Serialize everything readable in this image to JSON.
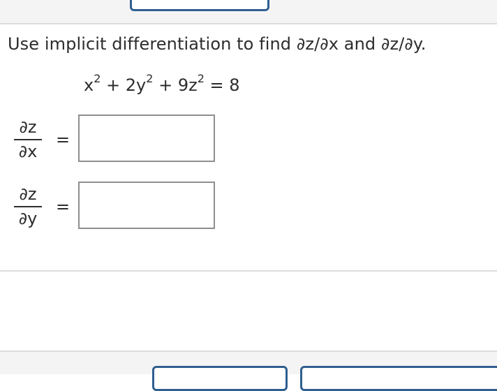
{
  "question": {
    "text": "Use implicit differentiation to find ∂z/∂x and ∂z/∂y."
  },
  "equation": {
    "term1_base": "x",
    "term1_exp": "2",
    "op1": " + ",
    "term2_base": "2y",
    "term2_exp": "2",
    "op2": " + ",
    "term3_base": "9z",
    "term3_exp": "2",
    "rhs": " = 8"
  },
  "answers": [
    {
      "numerator": "∂z",
      "denominator": "∂x",
      "equals": "=",
      "value": ""
    },
    {
      "numerator": "∂z",
      "denominator": "∂y",
      "equals": "=",
      "value": ""
    }
  ],
  "colors": {
    "button_border": "#2f5f8f",
    "input_border": "#8e8e8e",
    "text": "#2d2d2d"
  }
}
